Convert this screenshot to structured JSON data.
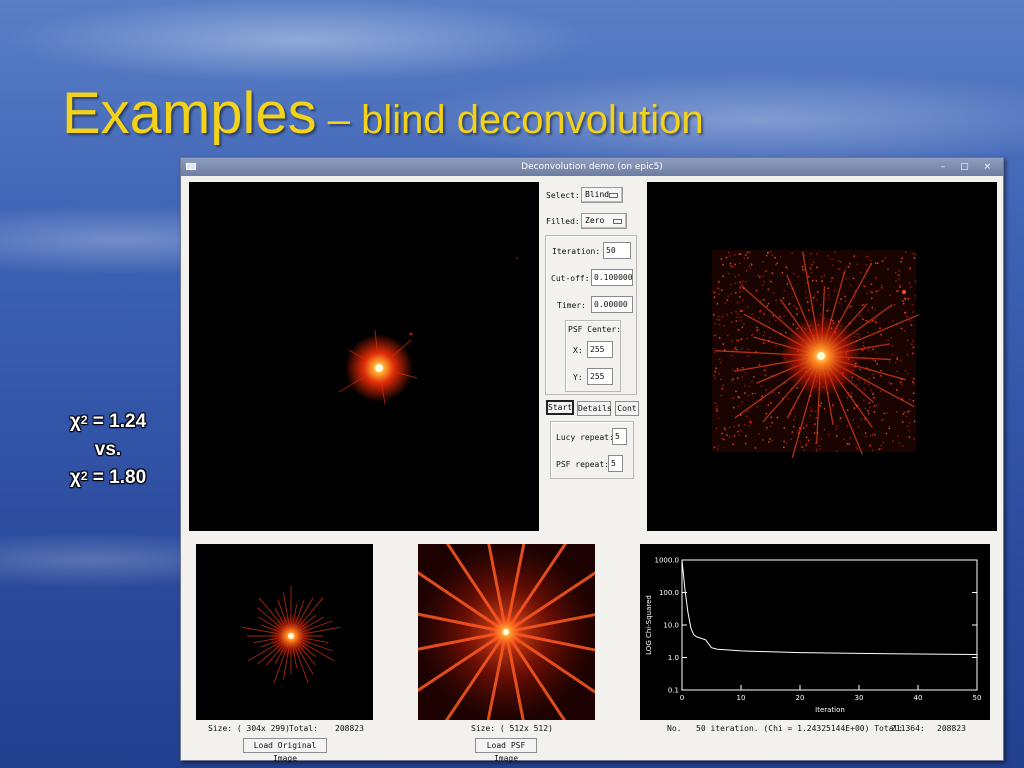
{
  "slide": {
    "title_main": "Examples",
    "title_sub": " – blind deconvolution",
    "chi_line1_prefix": "χ",
    "chi_line1_sup": "2",
    "chi_line1_value": " = 1.24",
    "vs": "vs.",
    "chi_line2_prefix": "χ",
    "chi_line2_sup": "2",
    "chi_line2_value": " = 1.80"
  },
  "window": {
    "title": "Deconvolution demo (on epic5)",
    "controls": "– □ ×"
  },
  "controls": {
    "select_label": "Select:",
    "select_value": "Blind",
    "filled_label": "Filled:",
    "filled_value": "Zero",
    "iteration_label": "Iteration:",
    "iteration_value": "50",
    "cutoff_label": "Cut-off:",
    "cutoff_value": "0.100000",
    "timer_label": "Timer:",
    "timer_value": "0.00000",
    "psf_center_label": "PSF Center:",
    "x_label": "X:",
    "x_value": "255",
    "y_label": "Y:",
    "y_value": "255",
    "start_label": "Start",
    "details_label": "Details",
    "cont_label": "Cont",
    "lucy_label": "Lucy repeat:",
    "lucy_value": "5",
    "psf_repeat_label": "PSF repeat:",
    "psf_repeat_value": "5"
  },
  "info": {
    "original_size": "Size: ( 304x 299)",
    "original_total_label": "Total:",
    "original_total": "208823",
    "load_original": "Load Original Image",
    "psf_size": "Size: ( 512x 512)",
    "load_psf": "Load PSF Image",
    "status_no": "No.",
    "status_text": "50 iteration. (Chi = 1.24325144E+00) Total:",
    "status_total_a": "211364:",
    "status_total_b": "208823"
  },
  "colors": {
    "title_yellow": "#f2d21a",
    "star_red": "#ff3a10",
    "window_bg": "#f3f1ee"
  },
  "chart_data": {
    "type": "line",
    "title": "",
    "xlabel": "Iteration",
    "ylabel": "LOG Chi-Squared",
    "xlim": [
      0,
      50
    ],
    "ylim": [
      0.1,
      1000
    ],
    "y_scale": "log",
    "x_ticks": [
      "0",
      "10",
      "20",
      "30",
      "40",
      "50"
    ],
    "y_ticks": [
      "0.1",
      "1.0",
      "10.0",
      "100.0",
      "1000.0"
    ],
    "x": [
      0,
      0.5,
      1,
      1.5,
      2,
      2.5,
      3,
      4,
      5,
      6,
      8,
      10,
      15,
      20,
      25,
      30,
      35,
      40,
      45,
      50
    ],
    "y": [
      1000,
      120,
      25,
      8,
      5,
      4.3,
      4,
      3.5,
      2,
      1.8,
      1.7,
      1.6,
      1.5,
      1.42,
      1.38,
      1.34,
      1.31,
      1.28,
      1.26,
      1.24
    ]
  }
}
